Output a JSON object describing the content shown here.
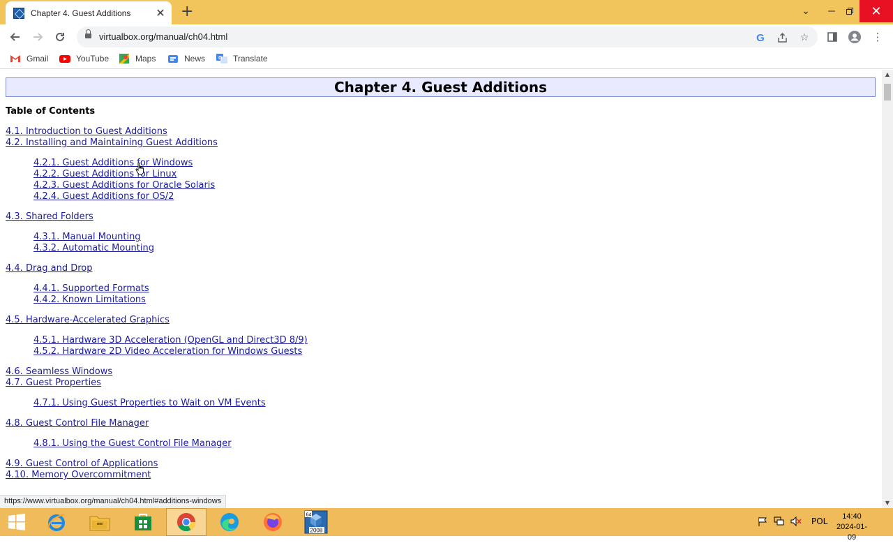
{
  "browser": {
    "tab": {
      "title": "Chapter 4. Guest Additions"
    },
    "url": "virtualbox.org/manual/ch04.html",
    "bookmarks": [
      {
        "label": "Gmail",
        "icon": "gmail-icon"
      },
      {
        "label": "YouTube",
        "icon": "youtube-icon"
      },
      {
        "label": "Maps",
        "icon": "maps-icon"
      },
      {
        "label": "News",
        "icon": "news-icon"
      },
      {
        "label": "Translate",
        "icon": "translate-icon"
      }
    ],
    "status_url": "https://www.virtualbox.org/manual/ch04.html#additions-windows"
  },
  "page": {
    "chapter_title": "Chapter 4. Guest Additions",
    "toc_heading": "Table of Contents",
    "toc": [
      {
        "text": "4.1. Introduction to Guest Additions",
        "level": 1
      },
      {
        "text": "4.2. Installing and Maintaining Guest Additions",
        "level": 1
      },
      {
        "text": "4.2.1. Guest Additions for Windows",
        "level": 2
      },
      {
        "text": "4.2.2. Guest Additions for Linux",
        "level": 2
      },
      {
        "text": "4.2.3. Guest Additions for Oracle Solaris",
        "level": 2
      },
      {
        "text": "4.2.4. Guest Additions for OS/2",
        "level": 2
      },
      {
        "text": "4.3. Shared Folders",
        "level": 1
      },
      {
        "text": "4.3.1. Manual Mounting",
        "level": 2
      },
      {
        "text": "4.3.2. Automatic Mounting",
        "level": 2
      },
      {
        "text": "4.4. Drag and Drop",
        "level": 1
      },
      {
        "text": "4.4.1. Supported Formats",
        "level": 2
      },
      {
        "text": "4.4.2. Known Limitations",
        "level": 2
      },
      {
        "text": "4.5. Hardware-Accelerated Graphics",
        "level": 1
      },
      {
        "text": "4.5.1. Hardware 3D Acceleration (OpenGL and Direct3D 8/9)",
        "level": 2
      },
      {
        "text": "4.5.2. Hardware 2D Video Acceleration for Windows Guests",
        "level": 2
      },
      {
        "text": "4.6. Seamless Windows",
        "level": 1
      },
      {
        "text": "4.7. Guest Properties",
        "level": 1
      },
      {
        "text": "4.7.1. Using Guest Properties to Wait on VM Events",
        "level": 2
      },
      {
        "text": "4.8. Guest Control File Manager",
        "level": 1
      },
      {
        "text": "4.8.1. Using the Guest Control File Manager",
        "level": 2
      },
      {
        "text": "4.9. Guest Control of Applications",
        "level": 1
      },
      {
        "text": "4.10. Memory Overcommitment",
        "level": 1
      }
    ]
  },
  "taskbar": {
    "apps": [
      "internet-explorer-icon",
      "file-explorer-icon",
      "store-icon",
      "chrome-icon",
      "edge-icon",
      "firefox-icon",
      "virtualbox-icon"
    ],
    "virtualbox_badge": "64\n2008",
    "language": "POL",
    "time": "14:40",
    "date": "2024-01-09"
  }
}
